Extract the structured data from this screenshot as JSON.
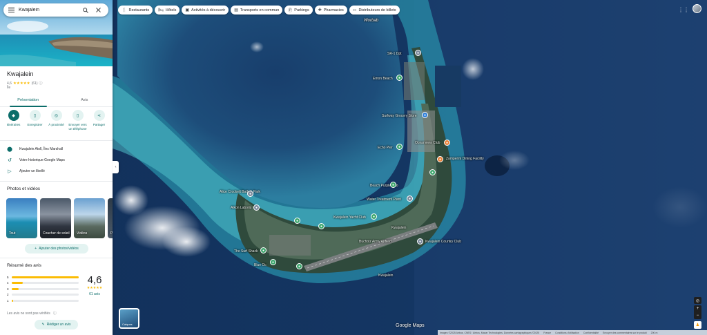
{
  "search": {
    "value": "Kwajalein"
  },
  "place": {
    "name": "Kwajalein",
    "rating": "4,6",
    "review_count": "(61)",
    "type": "Île"
  },
  "tabs": [
    {
      "label": "Présentation",
      "active": true
    },
    {
      "label": "Avis",
      "active": false
    }
  ],
  "actions": [
    {
      "label": "Itinéraires",
      "icon": "directions-icon"
    },
    {
      "label": "Enregistrer",
      "icon": "bookmark-icon"
    },
    {
      "label": "À proximité",
      "icon": "nearby-icon"
    },
    {
      "label": "Envoyer vers un téléphone",
      "icon": "phone-icon"
    },
    {
      "label": "Partager",
      "icon": "share-icon"
    }
  ],
  "info": {
    "address": "Kwajalein Atoll, Îles Marshall",
    "history": "Votre historique Google Maps",
    "label": "Ajouter un libellé"
  },
  "photos": {
    "title": "Photos et vidéos",
    "items": [
      "Tout",
      "Coucher de soleil",
      "Vidéos",
      "P"
    ],
    "add_button": "Ajouter des photos/vidéos"
  },
  "reviews": {
    "title": "Résumé des avis",
    "distribution": [
      {
        "stars": "5",
        "fraction": 1.0
      },
      {
        "stars": "4",
        "fraction": 0.16
      },
      {
        "stars": "3",
        "fraction": 0.1
      },
      {
        "stars": "2",
        "fraction": 0.0
      },
      {
        "stars": "1",
        "fraction": 0.02
      }
    ],
    "average": "4,6",
    "count_label": "61 avis",
    "unverified": "Les avis ne sont pas vérifiés",
    "write_button": "Rédiger un avis"
  },
  "chips": [
    {
      "label": "Restaurants",
      "icon": "restaurant-icon"
    },
    {
      "label": "Hôtels",
      "icon": "hotel-icon"
    },
    {
      "label": "Activités à découvrir",
      "icon": "activities-icon"
    },
    {
      "label": "Transports en commun",
      "icon": "transit-icon"
    },
    {
      "label": "Parkings",
      "icon": "parking-icon"
    },
    {
      "label": "Pharmacies",
      "icon": "pharmacy-icon"
    },
    {
      "label": "Distributeurs de billets",
      "icon": "atm-icon"
    }
  ],
  "map": {
    "labels": {
      "worbab": "Worbab",
      "sr1": "SR-1 Dpt",
      "emon": "Emon Beach",
      "surfway": "Surfway Grocery Store",
      "oceanview": "Oceanview Club",
      "zamperini": "Zamperini Dining Facility",
      "echo": "Echo Pier",
      "beach_purple": "Beach Purple Two",
      "water": "Water Treatment Plant",
      "yacht": "Kwajalein Yacht Club",
      "kwaj": "Kwajalein",
      "bucholz": "Bucholz Army Airfield",
      "country": "Kwajalein Country Club",
      "alice": "Alice Crockett Bath & Park",
      "aikon": "Aikon Laboris",
      "surf_shack": "The Surf Shack",
      "blue": "Blue Oc",
      "kwaj_south": "Kwajalein"
    },
    "layers_label": "Calques",
    "logo": "Google Maps",
    "footer": [
      "Images ©2025 Airbus, CNES / Airbus, Maxar Technologies, Données cartographiques ©2025",
      "France",
      "Conditions d'utilisation",
      "Confidentialité",
      "Envoyer des commentaires sur le produit",
      "200 m"
    ]
  },
  "colors": {
    "accent": "#0b6d6a",
    "star": "#fbbc04",
    "ocean": "#0e2a4a",
    "lagoon": "#2aa7b8"
  }
}
